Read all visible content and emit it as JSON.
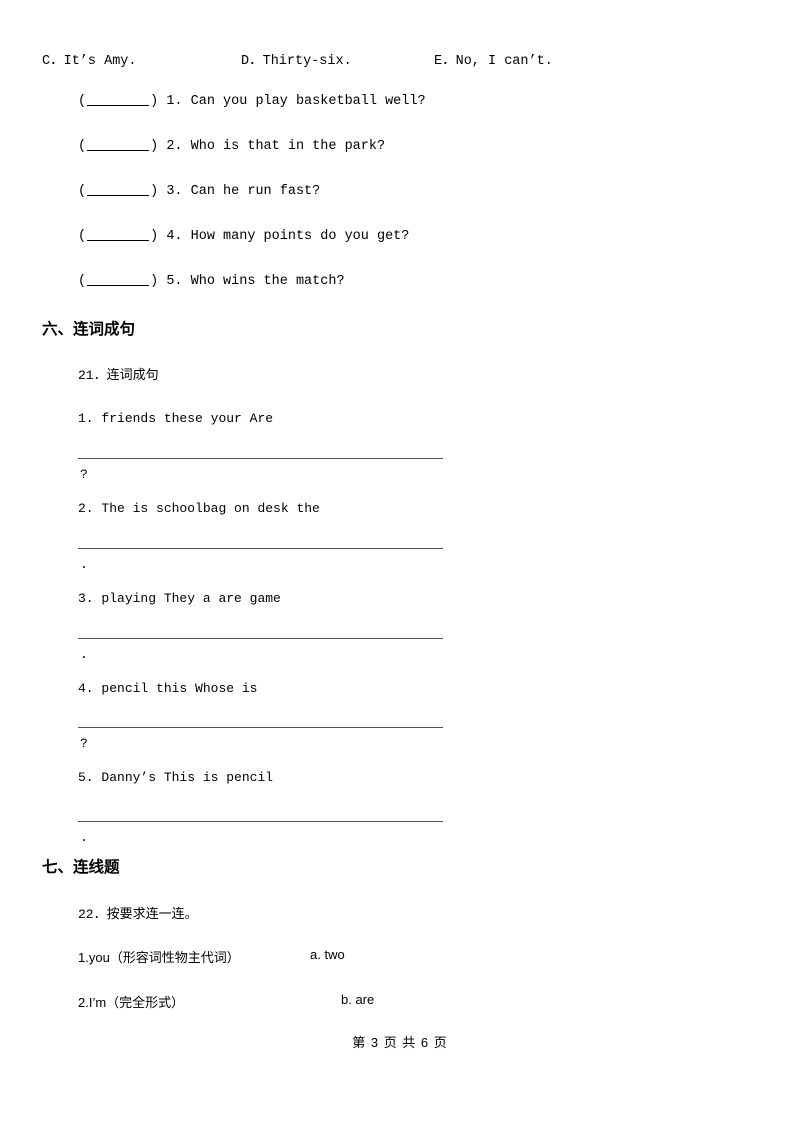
{
  "choices_row": {
    "c": "C．It’s Amy.",
    "d": "D．Thirty-six.",
    "e": "E．No, I can’t."
  },
  "matching_questions": [
    {
      "num": "1.",
      "text": "Can you play basketball well?"
    },
    {
      "num": "2.",
      "text": "Who is that in the park?"
    },
    {
      "num": "3.",
      "text": "Can he run fast?"
    },
    {
      "num": "4.",
      "text": "How many points do you get?"
    },
    {
      "num": "5.",
      "text": "Who wins the match?"
    }
  ],
  "section_six": {
    "heading": "六、连词成句",
    "prompt": "21．连词成句",
    "items": [
      {
        "num": "1.",
        "words": "friends  these  your  Are",
        "endmark": "?"
      },
      {
        "num": "2.",
        "words": "The  is  schoolbag  on  desk  the",
        "endmark": "."
      },
      {
        "num": "3.",
        "words": "playing  They  a  are  game",
        "endmark": "."
      },
      {
        "num": "4.",
        "words": "pencil  this  Whose  is",
        "endmark": "?"
      },
      {
        "num": "5.",
        "words": "Danny’s  This  is  pencil",
        "endmark": "."
      }
    ]
  },
  "section_seven": {
    "heading": "七、连线题",
    "prompt": "22．按要求连一连。",
    "items": [
      {
        "left": "1.you（形容词性物主代词）",
        "right": "a. two"
      },
      {
        "left": "2.I’m（完全形式）",
        "right": "b. are"
      }
    ]
  },
  "footer": {
    "text": "第 3 页 共 6 页"
  }
}
